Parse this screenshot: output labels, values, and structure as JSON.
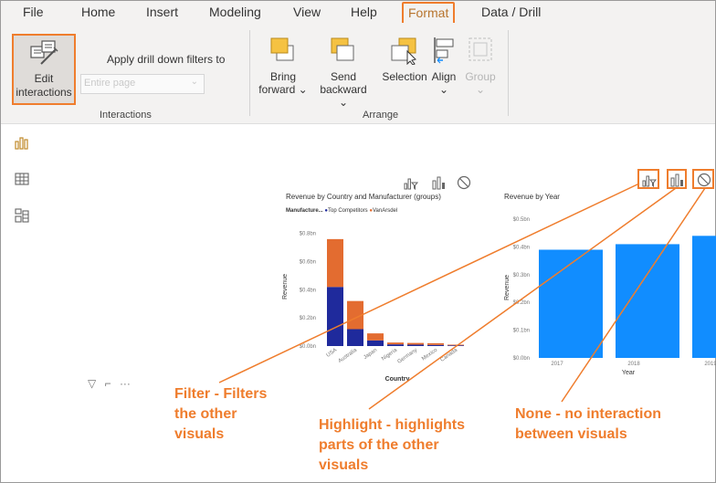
{
  "menu": {
    "items": [
      "File",
      "Home",
      "Insert",
      "Modeling",
      "View",
      "Help",
      "Format",
      "Data / Drill"
    ],
    "active": "Format"
  },
  "ribbon": {
    "edit_interactions": {
      "line1": "Edit",
      "line2": "interactions"
    },
    "apply_drill_label": "Apply drill down filters to",
    "drill_scope_value": "Entire page",
    "interactions_group": "Interactions",
    "bring_forward": {
      "line1": "Bring",
      "line2": "forward"
    },
    "send_backward": {
      "line1": "Send",
      "line2": "backward"
    },
    "selection": "Selection",
    "align": "Align",
    "group": "Group",
    "arrange_group": "Arrange"
  },
  "sidebar": {
    "icons": [
      "report-view-icon",
      "data-view-icon",
      "model-view-icon"
    ]
  },
  "visual_controls": [
    "filter-icon",
    "highlight-icon",
    "none-icon"
  ],
  "visual_header_glyphs": {
    "filter": "▽",
    "focus": "⌐",
    "more": "···"
  },
  "colors": {
    "accent": "#ef7d2d",
    "top_competitors": "#1f2a9c",
    "vanarsdel": "#e36c30",
    "year_bar": "#118dff"
  },
  "annotations": {
    "filter": [
      "Filter - Filters",
      "the other",
      "visuals"
    ],
    "highlight": [
      "Highlight - highlights",
      "parts of the other",
      "visuals"
    ],
    "none": [
      "None - no interaction",
      "between visuals"
    ]
  },
  "chart_data": [
    {
      "type": "bar",
      "title": "Revenue by Country and Manufacturer (groups)",
      "legend_title": "Manufacture...",
      "xlabel": "Country",
      "ylabel": "Revenue",
      "categories": [
        "USA",
        "Australia",
        "Japan",
        "Nigeria",
        "Germany",
        "Mexico",
        "Canada"
      ],
      "series": [
        {
          "name": "Top Competitors",
          "values": [
            0.42,
            0.12,
            0.04,
            0.012,
            0.01,
            0.008,
            0.005
          ]
        },
        {
          "name": "VanArsdel",
          "values": [
            0.34,
            0.2,
            0.05,
            0.013,
            0.012,
            0.012,
            0.005
          ]
        }
      ],
      "yticks": [
        "$0.0bn",
        "$0.2bn",
        "$0.4bn",
        "$0.6bn",
        "$0.8bn"
      ],
      "ylim": [
        0,
        0.85
      ],
      "stacked": true
    },
    {
      "type": "bar",
      "title": "Revenue by Year",
      "xlabel": "Year",
      "ylabel": "Revenue",
      "categories": [
        "2017",
        "2018",
        "2019"
      ],
      "values": [
        0.39,
        0.41,
        0.44
      ],
      "yticks": [
        "$0.0bn",
        "$0.1bn",
        "$0.2bn",
        "$0.3bn",
        "$0.4bn",
        "$0.5bn"
      ],
      "ylim": [
        0,
        0.52
      ]
    }
  ]
}
